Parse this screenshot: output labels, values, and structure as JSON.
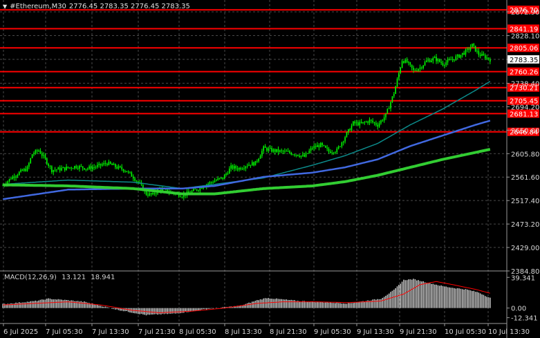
{
  "header": {
    "symbol_timeframe": "#Ethereum,M30",
    "ohlc": "2776.45 2783.35 2776.45 2783.35"
  },
  "macd_label": {
    "name": "MACD(12,26,9)",
    "main": "13.121",
    "signal": "18.941"
  },
  "colors": {
    "background": "#000000",
    "grid": "#4a4a4a",
    "candle": "#00ff00",
    "ma_fast": "#0c8b8b",
    "ma_mid": "#4169e1",
    "ma_slow": "#32cd32",
    "level_line": "#ff0000",
    "macd_hist": "#c0c0c0",
    "macd_signal": "#ff0000"
  },
  "chart_data": {
    "type": "candlestick",
    "price_axis_ticks": [
      "2872.90",
      "2828.10",
      "2783.35",
      "2738.40",
      "2694.20",
      "2650.00",
      "2605.80",
      "2561.60",
      "2517.40",
      "2473.20",
      "2429.00",
      "2384.80"
    ],
    "price_ylim": [
      2384.8,
      2890.0
    ],
    "current_price": "2783.35",
    "horizontal_levels": [
      "2876.70",
      "2841.19",
      "2805.06",
      "2760.26",
      "2730.21",
      "2705.45",
      "2681.13",
      "2646.84"
    ],
    "time_labels": [
      "6 Jul 2025",
      "7 Jul 05:30",
      "7 Jul 13:30",
      "7 Jul 21:30",
      "8 Jul 05:30",
      "8 Jul 13:30",
      "8 Jul 21:30",
      "9 Jul 05:30",
      "9 Jul 13:30",
      "9 Jul 21:30",
      "10 Jul 05:30",
      "10 Jul 13:30"
    ],
    "close_path": [
      [
        0,
        2546
      ],
      [
        5,
        2560
      ],
      [
        10,
        2570
      ],
      [
        15,
        2578
      ],
      [
        18,
        2605
      ],
      [
        22,
        2612
      ],
      [
        26,
        2595
      ],
      [
        30,
        2575
      ],
      [
        38,
        2578
      ],
      [
        45,
        2582
      ],
      [
        52,
        2578
      ],
      [
        58,
        2582
      ],
      [
        64,
        2588
      ],
      [
        70,
        2580
      ],
      [
        75,
        2575
      ],
      [
        80,
        2562
      ],
      [
        84,
        2548
      ],
      [
        88,
        2530
      ],
      [
        92,
        2528
      ],
      [
        96,
        2540
      ],
      [
        100,
        2535
      ],
      [
        105,
        2532
      ],
      [
        110,
        2527
      ],
      [
        115,
        2533
      ],
      [
        120,
        2540
      ],
      [
        125,
        2548
      ],
      [
        130,
        2555
      ],
      [
        135,
        2560
      ],
      [
        140,
        2580
      ],
      [
        145,
        2578
      ],
      [
        150,
        2585
      ],
      [
        155,
        2588
      ],
      [
        160,
        2616
      ],
      [
        165,
        2612
      ],
      [
        170,
        2610
      ],
      [
        175,
        2608
      ],
      [
        180,
        2605
      ],
      [
        185,
        2600
      ],
      [
        190,
        2617
      ],
      [
        195,
        2622
      ],
      [
        200,
        2610
      ],
      [
        205,
        2612
      ],
      [
        210,
        2638
      ],
      [
        215,
        2663
      ],
      [
        220,
        2662
      ],
      [
        225,
        2668
      ],
      [
        230,
        2660
      ],
      [
        235,
        2678
      ],
      [
        240,
        2720
      ],
      [
        245,
        2782
      ],
      [
        248,
        2778
      ],
      [
        252,
        2762
      ],
      [
        256,
        2768
      ],
      [
        260,
        2780
      ],
      [
        265,
        2785
      ],
      [
        270,
        2775
      ],
      [
        275,
        2782
      ],
      [
        280,
        2790
      ],
      [
        285,
        2800
      ],
      [
        288,
        2810
      ],
      [
        292,
        2793
      ],
      [
        296,
        2788
      ],
      [
        299,
        2783
      ]
    ],
    "ma_fast": [
      [
        0,
        2548
      ],
      [
        40,
        2556
      ],
      [
        80,
        2552
      ],
      [
        110,
        2540
      ],
      [
        130,
        2548
      ],
      [
        160,
        2560
      ],
      [
        190,
        2584
      ],
      [
        210,
        2602
      ],
      [
        230,
        2625
      ],
      [
        250,
        2660
      ],
      [
        270,
        2690
      ],
      [
        290,
        2725
      ],
      [
        299,
        2742
      ]
    ],
    "ma_mid": [
      [
        0,
        2520
      ],
      [
        40,
        2538
      ],
      [
        80,
        2540
      ],
      [
        110,
        2540
      ],
      [
        130,
        2545
      ],
      [
        160,
        2562
      ],
      [
        190,
        2570
      ],
      [
        210,
        2580
      ],
      [
        230,
        2595
      ],
      [
        250,
        2620
      ],
      [
        270,
        2640
      ],
      [
        290,
        2660
      ],
      [
        299,
        2668
      ]
    ],
    "ma_slow": [
      [
        0,
        2547
      ],
      [
        40,
        2545
      ],
      [
        80,
        2540
      ],
      [
        110,
        2530
      ],
      [
        130,
        2530
      ],
      [
        160,
        2540
      ],
      [
        190,
        2545
      ],
      [
        210,
        2553
      ],
      [
        230,
        2565
      ],
      [
        250,
        2580
      ],
      [
        270,
        2595
      ],
      [
        290,
        2608
      ],
      [
        299,
        2614
      ]
    ],
    "macd": {
      "ticks": [
        "39.341",
        "0.00",
        "-12.341"
      ],
      "ylim": [
        -18.0,
        44.0
      ],
      "histogram_path": [
        [
          0,
          5
        ],
        [
          10,
          7
        ],
        [
          20,
          9
        ],
        [
          28,
          12
        ],
        [
          40,
          10
        ],
        [
          50,
          8
        ],
        [
          60,
          3
        ],
        [
          70,
          -2
        ],
        [
          80,
          -6
        ],
        [
          88,
          -9
        ],
        [
          96,
          -8
        ],
        [
          106,
          -7
        ],
        [
          116,
          -4
        ],
        [
          126,
          -1
        ],
        [
          136,
          1
        ],
        [
          146,
          3
        ],
        [
          156,
          10
        ],
        [
          162,
          13
        ],
        [
          172,
          11
        ],
        [
          182,
          9
        ],
        [
          192,
          8
        ],
        [
          202,
          7
        ],
        [
          212,
          6
        ],
        [
          222,
          9
        ],
        [
          232,
          12
        ],
        [
          240,
          23
        ],
        [
          246,
          36
        ],
        [
          252,
          37
        ],
        [
          258,
          34
        ],
        [
          264,
          31
        ],
        [
          270,
          28
        ],
        [
          276,
          26
        ],
        [
          284,
          24
        ],
        [
          292,
          20
        ],
        [
          299,
          13
        ]
      ],
      "signal_path": [
        [
          0,
          4
        ],
        [
          20,
          6
        ],
        [
          40,
          8
        ],
        [
          60,
          4
        ],
        [
          80,
          -3
        ],
        [
          96,
          -6
        ],
        [
          116,
          -4
        ],
        [
          136,
          0
        ],
        [
          156,
          6
        ],
        [
          172,
          8
        ],
        [
          192,
          8
        ],
        [
          212,
          7
        ],
        [
          232,
          9
        ],
        [
          246,
          18
        ],
        [
          256,
          30
        ],
        [
          266,
          34
        ],
        [
          276,
          30
        ],
        [
          290,
          24
        ],
        [
          299,
          19
        ]
      ]
    }
  }
}
